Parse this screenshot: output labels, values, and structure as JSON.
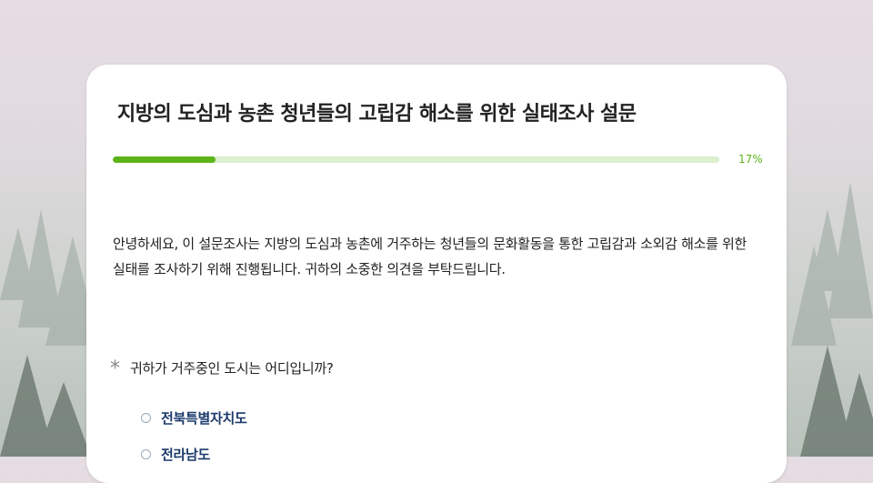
{
  "survey": {
    "title": "지방의 도심과 농촌 청년들의 고립감 해소를 위한 실태조사 설문",
    "progress": {
      "percent": 17,
      "label": "17%"
    },
    "intro": "안녕하세요, 이 설문조사는 지방의 도심과 농촌에 거주하는 청년들의 문화활동을 통한 고립감과 소외감 해소를 위한 실태를 조사하기 위해 진행됩니다. 귀하의 소중한 의견을 부탁드립니다.",
    "question": {
      "required_mark": "*",
      "text": "귀하가 거주중인 도시는 어디입니까?",
      "options": [
        "전북특별자치도",
        "전라남도"
      ]
    }
  },
  "colors": {
    "accent": "#5cb318",
    "track": "#dcefcf",
    "option_text": "#1b3a6b"
  },
  "icons": [
    "radio-unchecked-icon",
    "required-asterisk-icon"
  ]
}
